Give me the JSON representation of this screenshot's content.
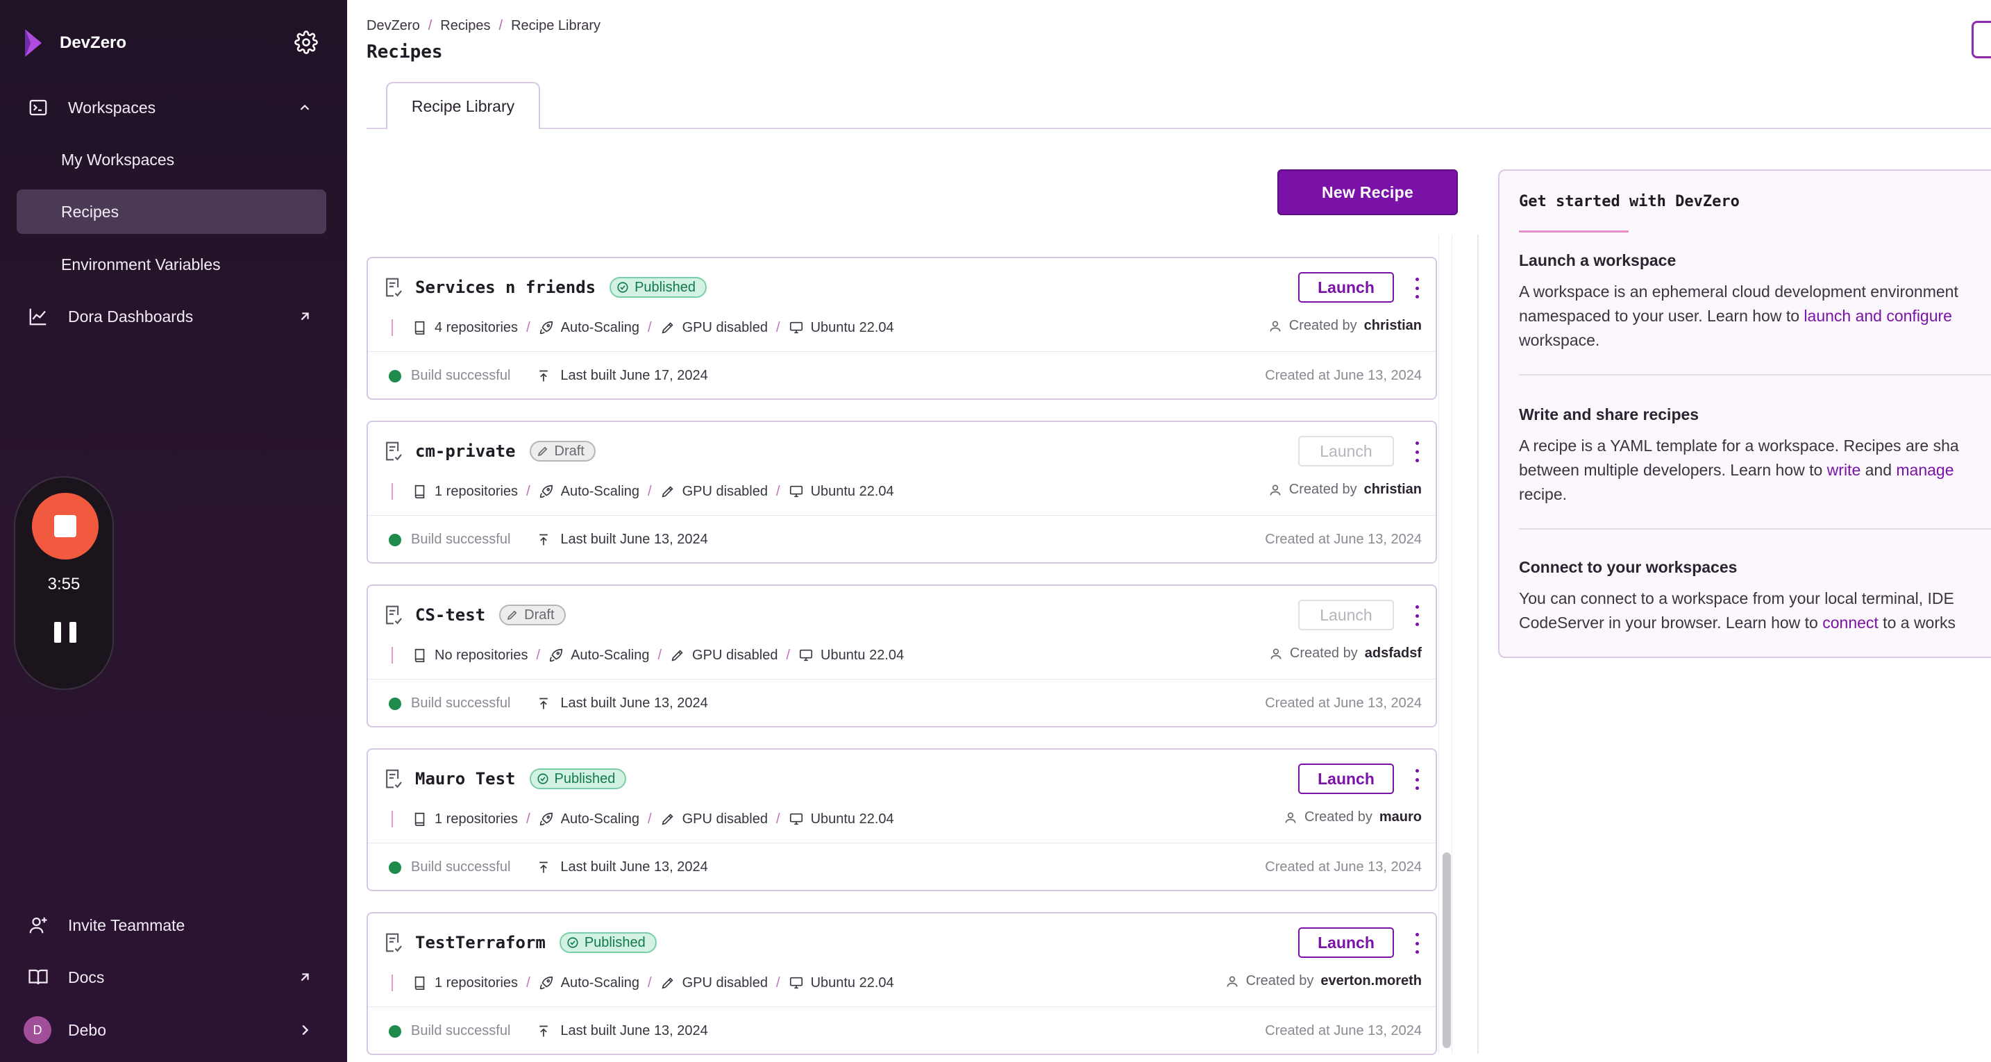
{
  "sidebar": {
    "brand": "DevZero",
    "nav": {
      "workspaces": "Workspaces",
      "my_workspaces": "My Workspaces",
      "recipes": "Recipes",
      "env_vars": "Environment Variables",
      "dora": "Dora Dashboards",
      "invite": "Invite Teammate",
      "docs": "Docs",
      "user": "Debo",
      "user_initial": "D"
    },
    "recorder": {
      "time": "3:55"
    }
  },
  "header": {
    "breadcrumb": [
      "DevZero",
      "Recipes",
      "Recipe Library"
    ],
    "separator": "/",
    "title": "Recipes",
    "tab": "Recipe Library"
  },
  "actions": {
    "new_recipe": "New Recipe"
  },
  "recipes": [
    {
      "name": "Services n friends",
      "status": "Published",
      "launch": "Launch",
      "repos": "4 repositories",
      "scaling": "Auto-Scaling",
      "gpu": "GPU disabled",
      "os": "Ubuntu 22.04",
      "created_by_label": "Created by",
      "creator": "christian",
      "build": "Build successful",
      "last_built": "Last built June 17, 2024",
      "created_at": "Created at June 13, 2024"
    },
    {
      "name": "cm-private",
      "status": "Draft",
      "launch": "Launch",
      "repos": "1 repositories",
      "scaling": "Auto-Scaling",
      "gpu": "GPU disabled",
      "os": "Ubuntu 22.04",
      "created_by_label": "Created by",
      "creator": "christian",
      "build": "Build successful",
      "last_built": "Last built June 13, 2024",
      "created_at": "Created at June 13, 2024"
    },
    {
      "name": "CS-test",
      "status": "Draft",
      "launch": "Launch",
      "repos": "No repositories",
      "scaling": "Auto-Scaling",
      "gpu": "GPU disabled",
      "os": "Ubuntu 22.04",
      "created_by_label": "Created by",
      "creator": "adsfadsf",
      "build": "Build successful",
      "last_built": "Last built June 13, 2024",
      "created_at": "Created at June 13, 2024"
    },
    {
      "name": "Mauro Test",
      "status": "Published",
      "launch": "Launch",
      "repos": "1 repositories",
      "scaling": "Auto-Scaling",
      "gpu": "GPU disabled",
      "os": "Ubuntu 22.04",
      "created_by_label": "Created by",
      "creator": "mauro",
      "build": "Build successful",
      "last_built": "Last built June 13, 2024",
      "created_at": "Created at June 13, 2024"
    },
    {
      "name": "TestTerraform",
      "status": "Published",
      "launch": "Launch",
      "repos": "1 repositories",
      "scaling": "Auto-Scaling",
      "gpu": "GPU disabled",
      "os": "Ubuntu 22.04",
      "created_by_label": "Created by",
      "creator": "everton.moreth",
      "build": "Build successful",
      "last_built": "Last built June 13, 2024",
      "created_at": "Created at June 13, 2024"
    }
  ],
  "panel": {
    "title": "Get started with DevZero",
    "launch": {
      "heading": "Launch a workspace",
      "line1": "A workspace is an ephemeral cloud development environment",
      "line2_pre": "namespaced to your user. Learn how to ",
      "line2_link": "launch and configure",
      "line3": "workspace."
    },
    "write": {
      "heading": "Write and share recipes",
      "line1": "A recipe is a YAML template for a workspace. Recipes are sha",
      "line2_pre": "between multiple developers. Learn how to ",
      "line2_link1": "write",
      "line2_mid": " and ",
      "line2_link2": "manage",
      "line3": "recipe."
    },
    "connect": {
      "heading": "Connect to your workspaces",
      "line1": "You can connect to a workspace from your local terminal, IDE",
      "line2_pre": "CodeServer in your browser. Learn how to ",
      "line2_link": "connect",
      "line2_post": " to a works"
    }
  },
  "colors": {
    "accent": "#7a12a8",
    "sidebar_bg": "#241428",
    "published": "#0f7a4a",
    "success_dot": "#1f8b4c"
  }
}
